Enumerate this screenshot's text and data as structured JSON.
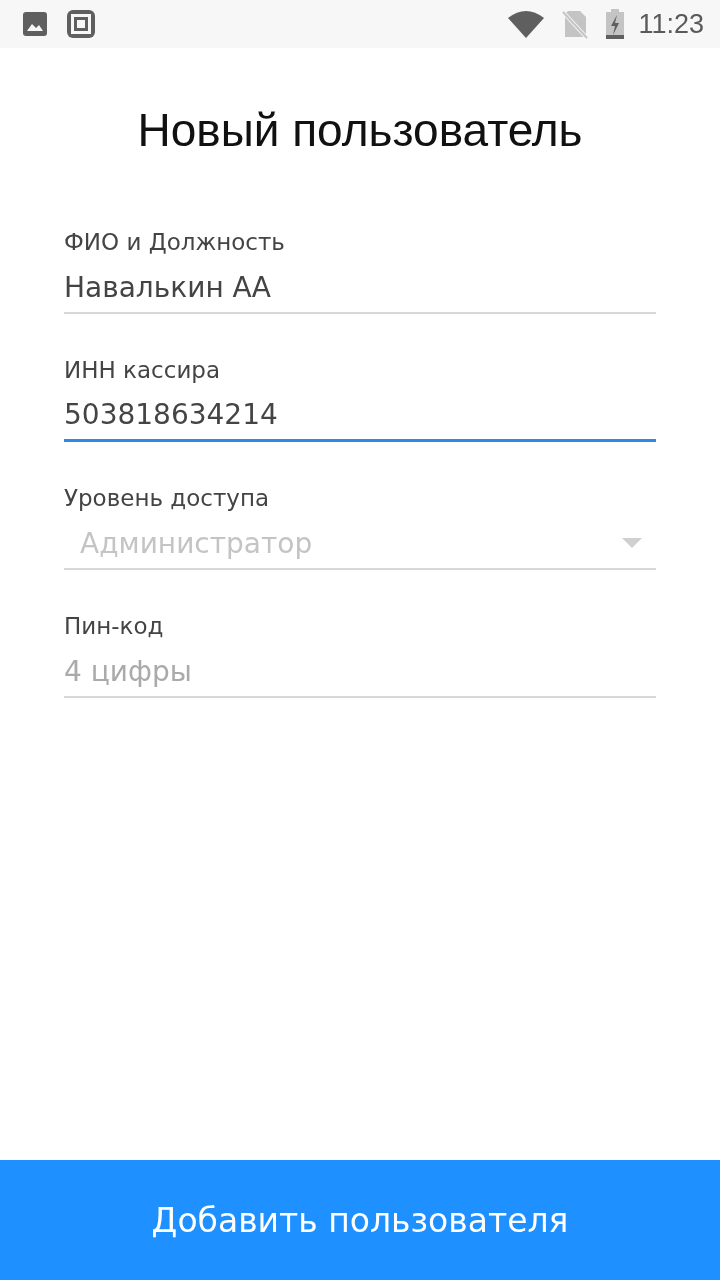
{
  "status_bar": {
    "time": "11:23"
  },
  "title": "Новый пользователь",
  "fields": [
    {
      "kind": "text",
      "label": "ФИО и Должность",
      "value": "Навалькин АА",
      "focused": false
    },
    {
      "kind": "text",
      "label": "ИНН кассира",
      "value": "503818634214",
      "focused": true
    },
    {
      "kind": "select",
      "label": "Уровень доступа",
      "value": "Администратор",
      "disabled": true
    },
    {
      "kind": "text",
      "label": "Пин-код",
      "placeholder": "4 цифры",
      "focused": false
    }
  ],
  "submit_button": "Добавить пользователя"
}
